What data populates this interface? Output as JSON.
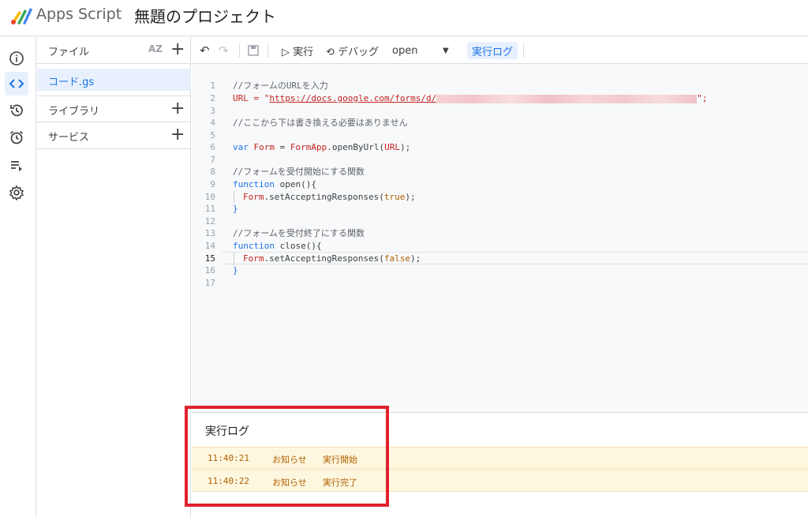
{
  "app": {
    "name": "Apps Script",
    "project_title": "無題のプロジェクト"
  },
  "rail": [
    "info-icon",
    "code-icon",
    "history-icon",
    "alarm-clock-icon",
    "executions-icon",
    "settings-gear-icon"
  ],
  "files": {
    "header": "ファイル",
    "sort_label": "AZ",
    "active_file": "コード.gs",
    "libraries": "ライブラリ",
    "services": "サービス",
    "plus": "+"
  },
  "toolbar": {
    "run": "▷ 実行",
    "debug": "⟲ デバッグ",
    "function_select": "open",
    "log_button": "実行ログ"
  },
  "code": {
    "l1": "//フォームのURLを入力",
    "l2a": "URL = \"",
    "l2b": "https://docs.google.com/forms/d/",
    "l2c": "\";",
    "l4": "//ここから下は書き換える必要はありません",
    "l6a": "var ",
    "l6b": "Form",
    "l6c": " = ",
    "l6d": "FormApp",
    "l6e": ".openByUrl(",
    "l6f": "URL",
    "l6g": ");",
    "l8": "//フォームを受付開始にする関数",
    "l9a": "function",
    "l9b": " open(){",
    "l10a": "Form",
    "l10b": ".setAcceptingResponses(",
    "l10c": "true",
    "l10d": ");",
    "l11": "}",
    "l13": "//フォームを受付終了にする関数",
    "l14a": "function",
    "l14b": " close(){",
    "l15a": "Form",
    "l15b": ".setAcceptingResponses(",
    "l15c": "false",
    "l15d": ");",
    "l16": "}",
    "line_numbers": [
      "1",
      "2",
      "3",
      "4",
      "5",
      "6",
      "7",
      "8",
      "9",
      "10",
      "11",
      "12",
      "13",
      "14",
      "15",
      "16",
      "17"
    ]
  },
  "log": {
    "title": "実行ログ",
    "rows": [
      {
        "time": "11:40:21",
        "level": "お知らせ",
        "message": "実行開始"
      },
      {
        "time": "11:40:22",
        "level": "お知らせ",
        "message": "実行完了"
      }
    ]
  },
  "colors": {
    "accent": "#1a73e8",
    "highlight_box": "#e0212e",
    "log_row_bg": "#fef7e0"
  }
}
